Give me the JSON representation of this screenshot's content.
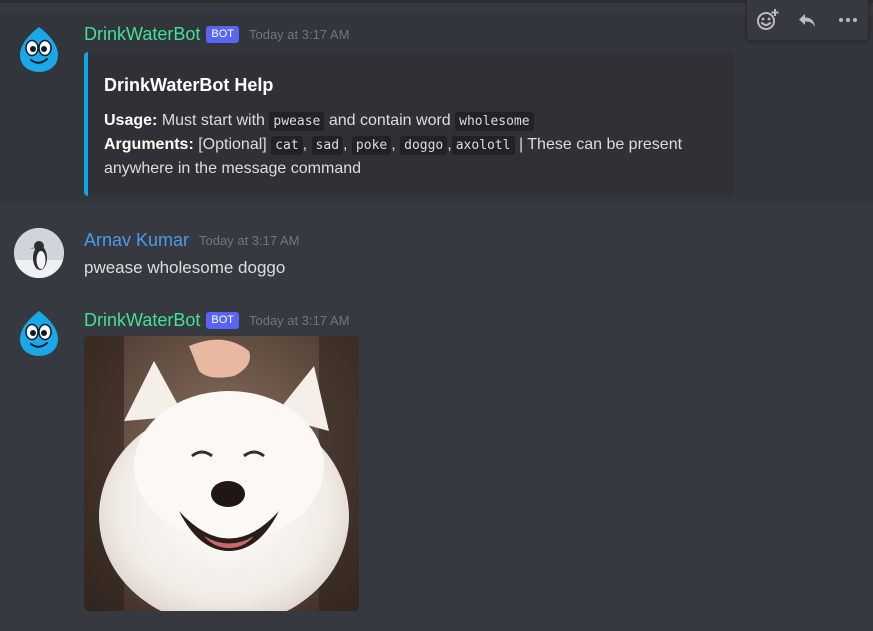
{
  "colors": {
    "background": "#36393f",
    "bot_name": "#43e097",
    "user_name": "#4c9be8",
    "embed_accent": "#0ea5e9",
    "bot_tag": "#5865f2"
  },
  "toolbar": {
    "icons": [
      "add-reaction-icon",
      "reply-icon",
      "more-icon"
    ]
  },
  "messages": {
    "bot_help": {
      "author": "DrinkWaterBot",
      "bot_tag": "BOT",
      "timestamp": "Today at 3:17 AM",
      "embed": {
        "title": "DrinkWaterBot Help",
        "usage_label": "Usage:",
        "usage_text_1": "Must start with",
        "usage_code_1": "pwease",
        "usage_text_2": "and contain word",
        "usage_code_2": "wholesome",
        "arguments_label": "Arguments:",
        "arguments_optional": "[Optional]",
        "arguments_codes": [
          "cat",
          "sad",
          "poke",
          "doggo",
          "axolotl"
        ],
        "arguments_tail": "| These can be present anywhere in the message command"
      }
    },
    "user_msg": {
      "author": "Arnav Kumar",
      "timestamp": "Today at 3:17 AM",
      "text": "pwease wholesome doggo"
    },
    "bot_image": {
      "author": "DrinkWaterBot",
      "bot_tag": "BOT",
      "timestamp": "Today at 3:17 AM"
    }
  }
}
